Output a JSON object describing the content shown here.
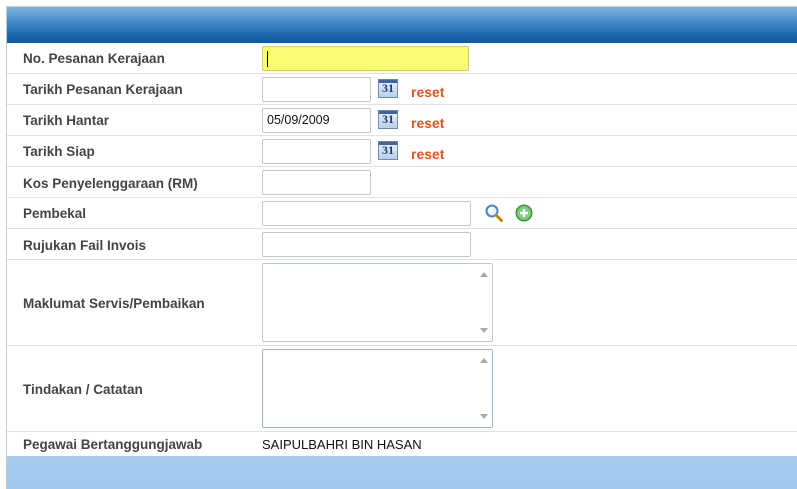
{
  "form": {
    "fields": [
      {
        "label": "No. Pesanan Kerajaan",
        "value": ""
      },
      {
        "label": "Tarikh Pesanan Kerajaan",
        "value": ""
      },
      {
        "label": "Tarikh Hantar",
        "value": "05/09/2009"
      },
      {
        "label": "Tarikh Siap",
        "value": ""
      },
      {
        "label": "Kos Penyelenggaraan (RM)",
        "value": ""
      },
      {
        "label": "Pembekal",
        "value": ""
      },
      {
        "label": "Rujukan Fail Invois",
        "value": ""
      },
      {
        "label": "Maklumat Servis/Pembaikan",
        "value": ""
      },
      {
        "label": "Tindakan / Catatan",
        "value": ""
      },
      {
        "label": "Pegawai Bertanggungjawab",
        "value": "SAIPULBAHRI BIN HASAN"
      }
    ],
    "calendar_icon_text": "31",
    "reset_label": "reset",
    "highlight_color": "#fbfb73",
    "reset_color": "#e4541c",
    "header_color": "#1a64a8",
    "footer_color": "#a6ccef"
  },
  "icons": {
    "search": "search-icon",
    "add": "add-icon",
    "calendar": "calendar-icon"
  }
}
